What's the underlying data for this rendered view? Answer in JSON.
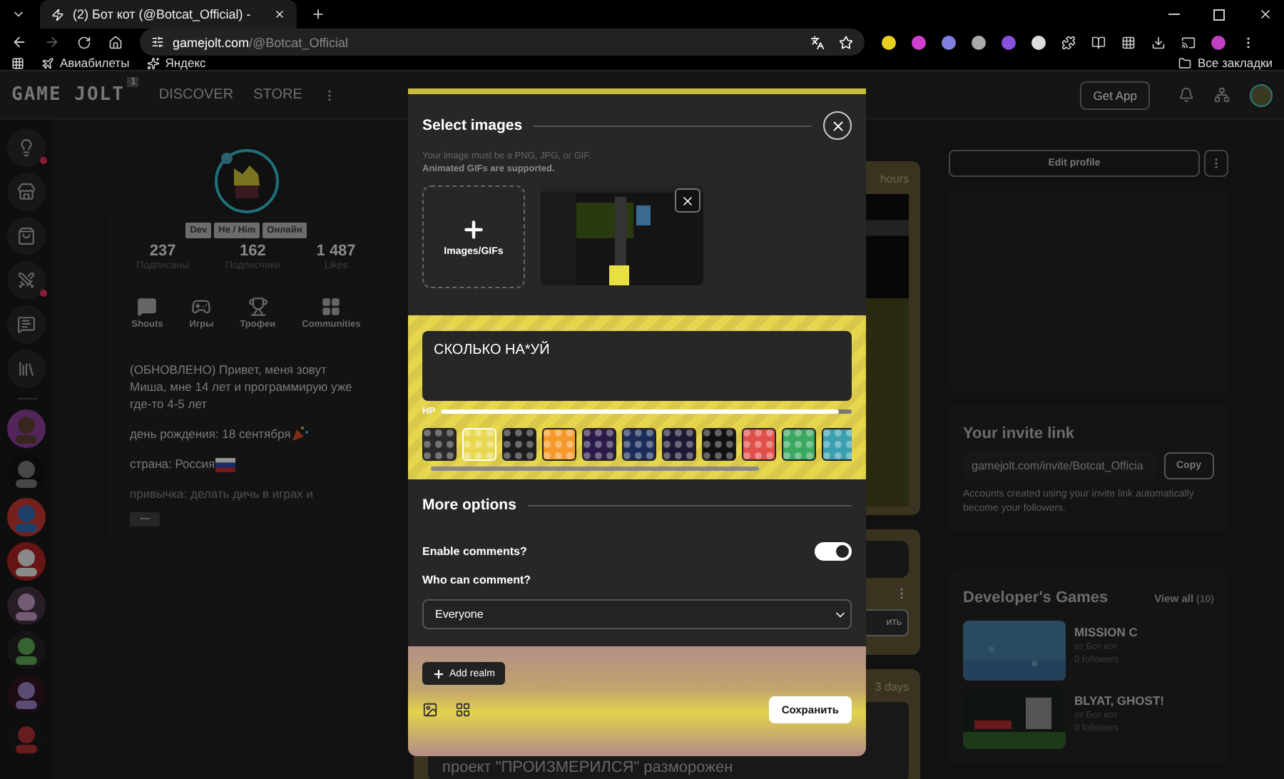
{
  "browser": {
    "tab_title": "(2) Бот кот (@Botcat_Official) -",
    "url_host": "gamejolt.com",
    "url_path": "/@Botcat_Official",
    "bookmarks": [
      {
        "kind": "plane",
        "label": "Авиабилеты"
      },
      {
        "kind": "star",
        "label": "Яндекс"
      }
    ],
    "all_bookmarks": "Все закладки"
  },
  "nav": {
    "logo": "GAME JOLT",
    "logo_badge": "1",
    "links": [
      "DISCOVER",
      "STORE"
    ],
    "get_app": "Get App"
  },
  "sidebar": {
    "items": [
      {
        "kind": "bulb",
        "notify": true
      },
      {
        "kind": "store",
        "notify": false
      },
      {
        "kind": "bag",
        "notify": false
      },
      {
        "kind": "quest",
        "notify": true
      },
      {
        "kind": "chat",
        "notify": false
      },
      {
        "kind": "library",
        "notify": false
      }
    ]
  },
  "profile": {
    "tags": [
      "Dev",
      "He / Him",
      "Онлайн"
    ],
    "stats": [
      {
        "value": "237",
        "label": "Подписаны"
      },
      {
        "value": "162",
        "label": "Подписчики"
      },
      {
        "value": "1 487",
        "label": "Likes"
      }
    ],
    "sections": [
      {
        "kind": "shouts",
        "label": "Shouts"
      },
      {
        "kind": "games",
        "label": "Игры"
      },
      {
        "kind": "trophies",
        "label": "Трофеи"
      },
      {
        "kind": "communities",
        "label": "Communities"
      }
    ],
    "bio": [
      {
        "kind": "plain",
        "text": "(ОБНОВЛЕНО) Привет, меня зовут Миша, мне 14 лет и программирую уже где-то 4-5 лет"
      },
      {
        "kind": "party",
        "text": "день рождения: 18 сентября"
      },
      {
        "kind": "flag",
        "text": "страна: Россия"
      },
      {
        "kind": "faded",
        "text": "привычка: делать дичь в играх и"
      }
    ]
  },
  "feed": {
    "cards": [
      {
        "kind": "time",
        "text": "hours"
      },
      {
        "kind": "button",
        "text": "ить"
      },
      {
        "kind": "post",
        "time": "3 days",
        "text": "проект \"ПРОИЗМЕРИЛСЯ\" разморожен"
      }
    ]
  },
  "modal": {
    "title": "Select images",
    "hint": [
      "Your image must be a PNG, JPG, or GIF.",
      "Animated GIFs are supported."
    ],
    "upload_label": "Images/GIFs",
    "text": "СКОЛЬКО НА*УЙ",
    "hp": {
      "label": "HP",
      "level": 0.97
    },
    "backgrounds": [
      {
        "color": "#2a2a2a",
        "selected": false
      },
      {
        "color": "#e8d850",
        "selected": true
      },
      {
        "color": "#1c1c1c",
        "selected": false
      },
      {
        "color": "#f59a2a",
        "selected": false
      },
      {
        "color": "#2a1a48",
        "selected": false
      },
      {
        "color": "#1c2c58",
        "selected": false
      },
      {
        "color": "#1e1834",
        "selected": false
      },
      {
        "color": "#101010",
        "selected": false
      },
      {
        "color": "#e0504a",
        "selected": false
      },
      {
        "color": "#3aa860",
        "selected": false
      },
      {
        "color": "#3aa0b0",
        "selected": false
      }
    ],
    "options_title": "More options",
    "enable_comments": {
      "label": "Enable comments?",
      "on": true
    },
    "who_label": "Who can comment?",
    "who_value": "Everyone",
    "add_realm": "Add realm",
    "save": "Сохранить"
  },
  "right": {
    "edit_profile": "Edit profile",
    "invite": {
      "title": "Your invite link",
      "link": "gamejolt.com/invite/Botcat_Officia",
      "copy": "Copy",
      "note": "Accounts created using your invite link automatically become your followers."
    },
    "games": {
      "title": "Developer's Games",
      "view_all": "View all",
      "count": "(10)",
      "items": [
        {
          "kind": "sky",
          "title": "MISSION C",
          "author": "от Бот кот",
          "followers": "0 followers"
        },
        {
          "kind": "night",
          "title": "BLYAT, GHOST!",
          "author": "от Бот кот",
          "followers": "0 followers"
        }
      ]
    }
  }
}
